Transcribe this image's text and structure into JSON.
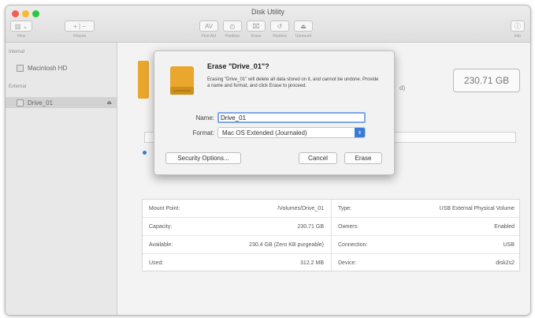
{
  "window": {
    "title": "Disk Utility",
    "traffic_colors": [
      "#f25f57",
      "#f7bc2e",
      "#28c840"
    ]
  },
  "toolbar": {
    "view_label": "View",
    "volume_label": "Volume",
    "view_icon": "sidebar-icon",
    "volume_icon": "plus-minus-icon",
    "actions": [
      {
        "icon": "stethoscope-icon",
        "glyph": "AV",
        "label": "First Aid"
      },
      {
        "icon": "partition-icon",
        "glyph": "◴",
        "label": "Partition"
      },
      {
        "icon": "erase-icon",
        "glyph": "⌧",
        "label": "Erase"
      },
      {
        "icon": "restore-icon",
        "glyph": "↺",
        "label": "Restore"
      },
      {
        "icon": "unmount-icon",
        "glyph": "⏏",
        "label": "Unmount"
      }
    ],
    "info_icon": "info-icon",
    "info_label": "Info"
  },
  "sidebar": {
    "internal_header": "Internal",
    "internal_items": [
      {
        "label": "Macintosh HD"
      }
    ],
    "external_header": "External",
    "external_items": [
      {
        "label": "Drive_01",
        "eject": "⏏"
      }
    ]
  },
  "main": {
    "capacity_box": "230.71 GB",
    "header_paren": "d)",
    "info": [
      {
        "l_key": "Mount Point:",
        "l_val": "/Volumes/Drive_01",
        "r_key": "Type:",
        "r_val": "USB External Physical Volume"
      },
      {
        "l_key": "Capacity:",
        "l_val": "230.71 GB",
        "r_key": "Owners:",
        "r_val": "Enabled"
      },
      {
        "l_key": "Available:",
        "l_val": "230.4 GB (Zero KB purgeable)",
        "r_key": "Connection:",
        "r_val": "USB"
      },
      {
        "l_key": "Used:",
        "l_val": "312.2 MB",
        "r_key": "Device:",
        "r_val": "disk2s2"
      }
    ]
  },
  "dialog": {
    "title": "Erase \"Drive_01\"?",
    "message": "Erasing \"Drive_01\" will delete all data stored on it, and cannot be undone. Provide a name and format, and click Erase to proceed.",
    "name_label": "Name:",
    "name_value": "Drive_01",
    "format_label": "Format:",
    "format_value": "Mac OS Extended (Journaled)",
    "security_button": "Security Options...",
    "cancel_button": "Cancel",
    "erase_button": "Erase",
    "accent": "#3a7ad9",
    "drive_color": "#e9a72d"
  }
}
